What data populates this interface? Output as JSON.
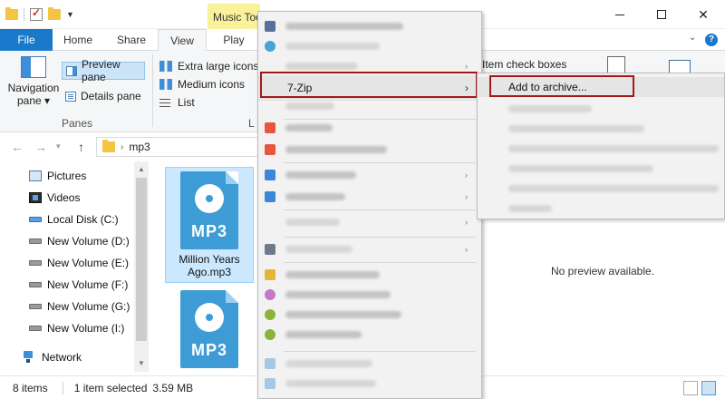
{
  "titlebar": {
    "contextual_tab": "Music Tools"
  },
  "tabs": {
    "file": "File",
    "home": "Home",
    "share": "Share",
    "view": "View",
    "play": "Play"
  },
  "ribbon": {
    "navigation_pane_line1": "Navigation",
    "navigation_pane_line2": "pane ▾",
    "preview_pane": "Preview pane",
    "details_pane": "Details pane",
    "panes_group": "Panes",
    "layout_items": [
      "Extra large icons",
      "Medium icons",
      "List"
    ],
    "layout_group": "L",
    "item_check_boxes": "Item check boxes"
  },
  "address": {
    "breadcrumb": "mp3"
  },
  "nav_tree": {
    "items": [
      {
        "label": "Pictures",
        "icon": "pictures-icon"
      },
      {
        "label": "Videos",
        "icon": "videos-icon"
      },
      {
        "label": "Local Disk (C:)",
        "icon": "drive-icon"
      },
      {
        "label": "New Volume (D:)",
        "icon": "drive-icon"
      },
      {
        "label": "New Volume (E:)",
        "icon": "drive-icon"
      },
      {
        "label": "New Volume (F:)",
        "icon": "drive-icon"
      },
      {
        "label": "New Volume (G:)",
        "icon": "drive-icon"
      },
      {
        "label": "New Volume (I:)",
        "icon": "drive-icon"
      },
      {
        "label": "Network",
        "icon": "network-icon"
      }
    ]
  },
  "files": [
    {
      "badge": "MP3",
      "name_line1": "Million Years",
      "name_line2": "Ago.mp3"
    },
    {
      "badge": "MP3",
      "name_line1": "",
      "name_line2": ""
    }
  ],
  "preview": {
    "message": "No preview available."
  },
  "context_menu": {
    "seven_zip": "7-Zip",
    "seven_zip_submenu": {
      "add_to_archive": "Add to archive..."
    }
  },
  "status": {
    "item_count": "8 items",
    "selection": "1 item selected",
    "size": "3.59 MB"
  },
  "colors": {
    "file_tab": "#1979ca",
    "music_tools": "#f9f29b",
    "highlight_border": "#a31919",
    "mp3_icon": "#3d9bd6",
    "selection": "#cce8ff"
  }
}
